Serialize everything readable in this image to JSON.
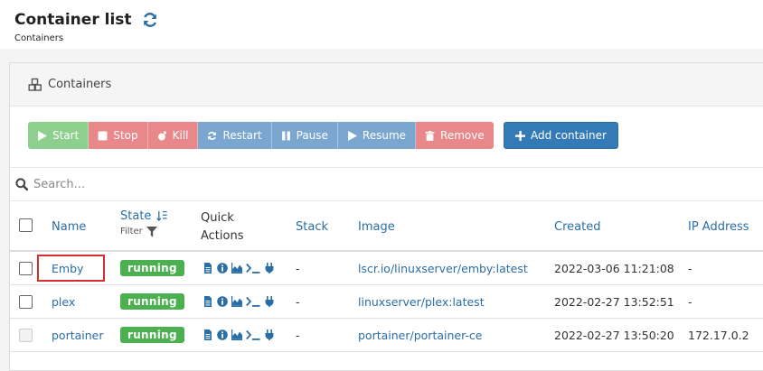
{
  "page": {
    "title": "Container list",
    "breadcrumb": "Containers"
  },
  "panel": {
    "heading": "Containers"
  },
  "toolbar": [
    {
      "label": "Start",
      "icon": "play-icon",
      "style": "success"
    },
    {
      "label": "Stop",
      "icon": "stop-icon",
      "style": "danger"
    },
    {
      "label": "Kill",
      "icon": "bomb-icon",
      "style": "danger"
    },
    {
      "label": "Restart",
      "icon": "sync-icon",
      "style": "primary"
    },
    {
      "label": "Pause",
      "icon": "pause-icon",
      "style": "primary"
    },
    {
      "label": "Resume",
      "icon": "play-icon",
      "style": "primary"
    },
    {
      "label": "Remove",
      "icon": "trash-icon",
      "style": "danger"
    }
  ],
  "add_button": {
    "label": "Add container"
  },
  "search": {
    "placeholder": "Search..."
  },
  "columns": {
    "name": "Name",
    "state": "State",
    "filter": "Filter",
    "quick_actions_1": "Quick",
    "quick_actions_2": "Actions",
    "stack": "Stack",
    "image": "Image",
    "created": "Created",
    "ip": "IP Address"
  },
  "rows": [
    {
      "name": "Emby",
      "state": "running",
      "stack": "-",
      "image": "lscr.io/linuxserver/emby:latest",
      "created": "2022-03-06 11:21:08",
      "ip": "-",
      "highlighted": true
    },
    {
      "name": "plex",
      "state": "running",
      "stack": "-",
      "image": "linuxserver/plex:latest",
      "created": "2022-02-27 13:52:51",
      "ip": "-",
      "highlighted": false
    },
    {
      "name": "portainer",
      "state": "running",
      "stack": "-",
      "image": "portainer/portainer-ce",
      "created": "2022-02-27 13:50:20",
      "ip": "172.17.0.2",
      "highlighted": false
    }
  ],
  "colors": {
    "accent": "#2a6ea6",
    "running": "#4caf50",
    "highlight": "#d32f2f",
    "primary_button": "#337ab7"
  }
}
